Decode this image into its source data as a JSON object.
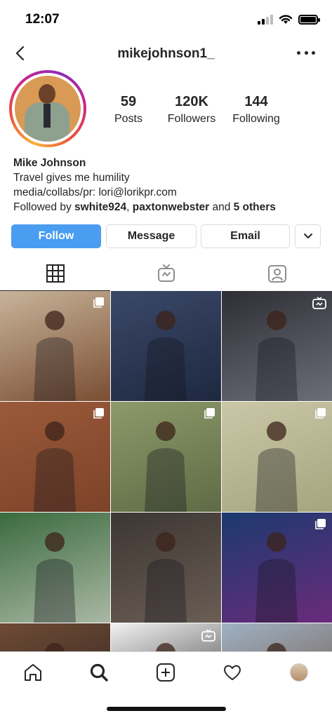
{
  "status_bar": {
    "time": "12:07"
  },
  "header": {
    "username": "mikejohnson1_"
  },
  "profile": {
    "stats": [
      {
        "value": "59",
        "label": "Posts"
      },
      {
        "value": "120K",
        "label": "Followers"
      },
      {
        "value": "144",
        "label": "Following"
      }
    ],
    "name": "Mike Johnson",
    "bio_line1": "Travel gives me humility",
    "bio_line2": "media/collabs/pr: lori@lorikpr.com",
    "followed_by_prefix": "Followed by ",
    "followed_user1": "swhite924",
    "followed_sep": ", ",
    "followed_user2": "paxtonwebster",
    "followed_and": " and ",
    "followed_others": "5 others"
  },
  "actions": {
    "follow": "Follow",
    "message": "Message",
    "email": "Email"
  },
  "tabs": [
    {
      "icon": "grid-icon"
    },
    {
      "icon": "igtv-icon"
    },
    {
      "icon": "tagged-icon"
    }
  ],
  "grid": [
    {
      "badge": "multi",
      "colors": [
        "#c8b49a",
        "#7a4e33"
      ]
    },
    {
      "badge": "none",
      "colors": [
        "#3a4868",
        "#1e2840"
      ]
    },
    {
      "badge": "igtv",
      "colors": [
        "#2e2e35",
        "#6c6e78"
      ]
    },
    {
      "badge": "multi",
      "colors": [
        "#9a5a3a",
        "#7d4228"
      ]
    },
    {
      "badge": "multi",
      "colors": [
        "#8d9a6a",
        "#5e6b45"
      ]
    },
    {
      "badge": "multi",
      "colors": [
        "#c9c7a6",
        "#a7a57f"
      ]
    },
    {
      "badge": "none",
      "colors": [
        "#3b6b3f",
        "#aab8a4"
      ]
    },
    {
      "badge": "none",
      "colors": [
        "#3d3632",
        "#6a5e55"
      ]
    },
    {
      "badge": "multi",
      "colors": [
        "#1b3a6e",
        "#6a2b7c"
      ]
    },
    {
      "badge": "none",
      "colors": [
        "#6e4a35",
        "#2b2320"
      ]
    },
    {
      "badge": "igtv",
      "colors": [
        "#f2f2f2",
        "#1a1a1a"
      ]
    },
    {
      "badge": "none",
      "colors": [
        "#9fb2c4",
        "#6b4a38"
      ]
    }
  ],
  "bottom_nav": [
    "home-icon",
    "search-icon",
    "add-post-icon",
    "activity-heart-icon",
    "profile-avatar"
  ]
}
